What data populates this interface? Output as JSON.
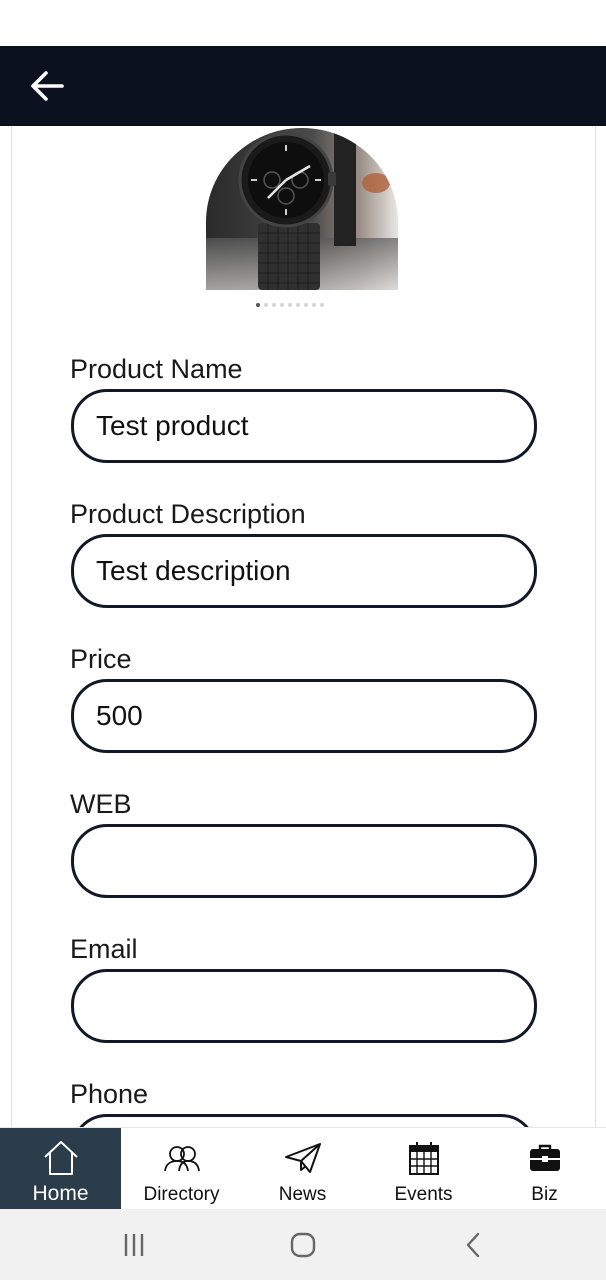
{
  "header": {
    "back_icon": "arrow-left-icon"
  },
  "carousel": {
    "image_alt": "black wristwatch with mesh strap",
    "slide_count": 9,
    "active_index": 0
  },
  "form": {
    "fields": [
      {
        "label": "Product Name",
        "value": "Test product"
      },
      {
        "label": "Product Description",
        "value": "Test description"
      },
      {
        "label": "Price",
        "value": "500"
      },
      {
        "label": "WEB",
        "value": ""
      },
      {
        "label": "Email",
        "value": ""
      },
      {
        "label": "Phone",
        "value": ""
      }
    ]
  },
  "bottom_nav": {
    "items": [
      {
        "label": "Home",
        "icon": "home-icon",
        "active": true
      },
      {
        "label": "Directory",
        "icon": "people-icon",
        "active": false
      },
      {
        "label": "News",
        "icon": "paper-plane-icon",
        "active": false
      },
      {
        "label": "Events",
        "icon": "calendar-icon",
        "active": false
      },
      {
        "label": "Biz",
        "icon": "briefcase-icon",
        "active": false
      }
    ]
  },
  "system_nav": {
    "icons": [
      "recent-apps-icon",
      "home-circle-icon",
      "back-chevron-icon"
    ]
  },
  "colors": {
    "app_bar": "#0c1120",
    "active_nav": "#2b3c4a",
    "input_border": "#111827"
  }
}
